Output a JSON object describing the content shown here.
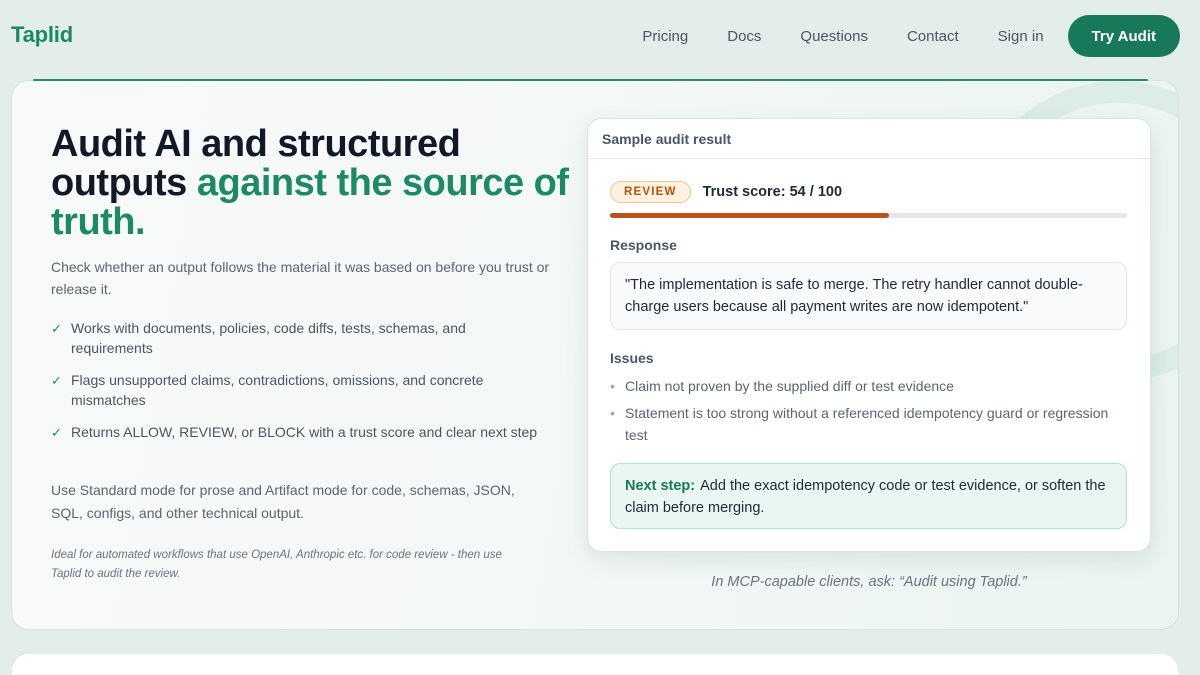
{
  "header": {
    "brand": "Taplid",
    "nav": [
      "Pricing",
      "Docs",
      "Questions",
      "Contact",
      "Sign in"
    ],
    "cta": "Try Audit"
  },
  "hero": {
    "title_plain": "Audit AI and structured outputs",
    "title_accent": "against the source of truth.",
    "subtitle": "Check whether an output follows the material it was based on before you trust or release it.",
    "features": [
      "Works with documents, policies, code diffs, tests, schemas, and requirements",
      "Flags unsupported claims, contradictions, omissions, and concrete mismatches",
      "Returns ALLOW, REVIEW, or BLOCK with a trust score and clear next step"
    ],
    "modes": "Use Standard mode for prose and Artifact mode for code, schemas, JSON, SQL, configs, and other technical output.",
    "ideal": "Ideal for automated workflows that use OpenAI, Anthropic etc. for code review - then use Taplid to audit the review."
  },
  "sample": {
    "heading": "Sample audit result",
    "badge": "REVIEW",
    "trust_label": "Trust score: 54 / 100",
    "trust_score": 54,
    "trust_max": 100,
    "response_label": "Response",
    "response_text": "\"The implementation is safe to merge. The retry handler cannot double-charge users because all payment writes are now idempotent.\"",
    "issues_label": "Issues",
    "issues": [
      "Claim not proven by the supplied diff or test evidence",
      "Statement is too strong without a referenced idempotency guard or regression test"
    ],
    "next_label": "Next step:",
    "next_text": "Add the exact idempotency code or test evidence, or soften the claim before merging."
  },
  "mcp_hint": "In MCP-capable clients, ask: “Audit using Taplid.”",
  "colors": {
    "brand": "#1a8a64",
    "cta_bg": "#17795a",
    "badge_review": "#b45309",
    "trust_bar": "#b9531a"
  }
}
